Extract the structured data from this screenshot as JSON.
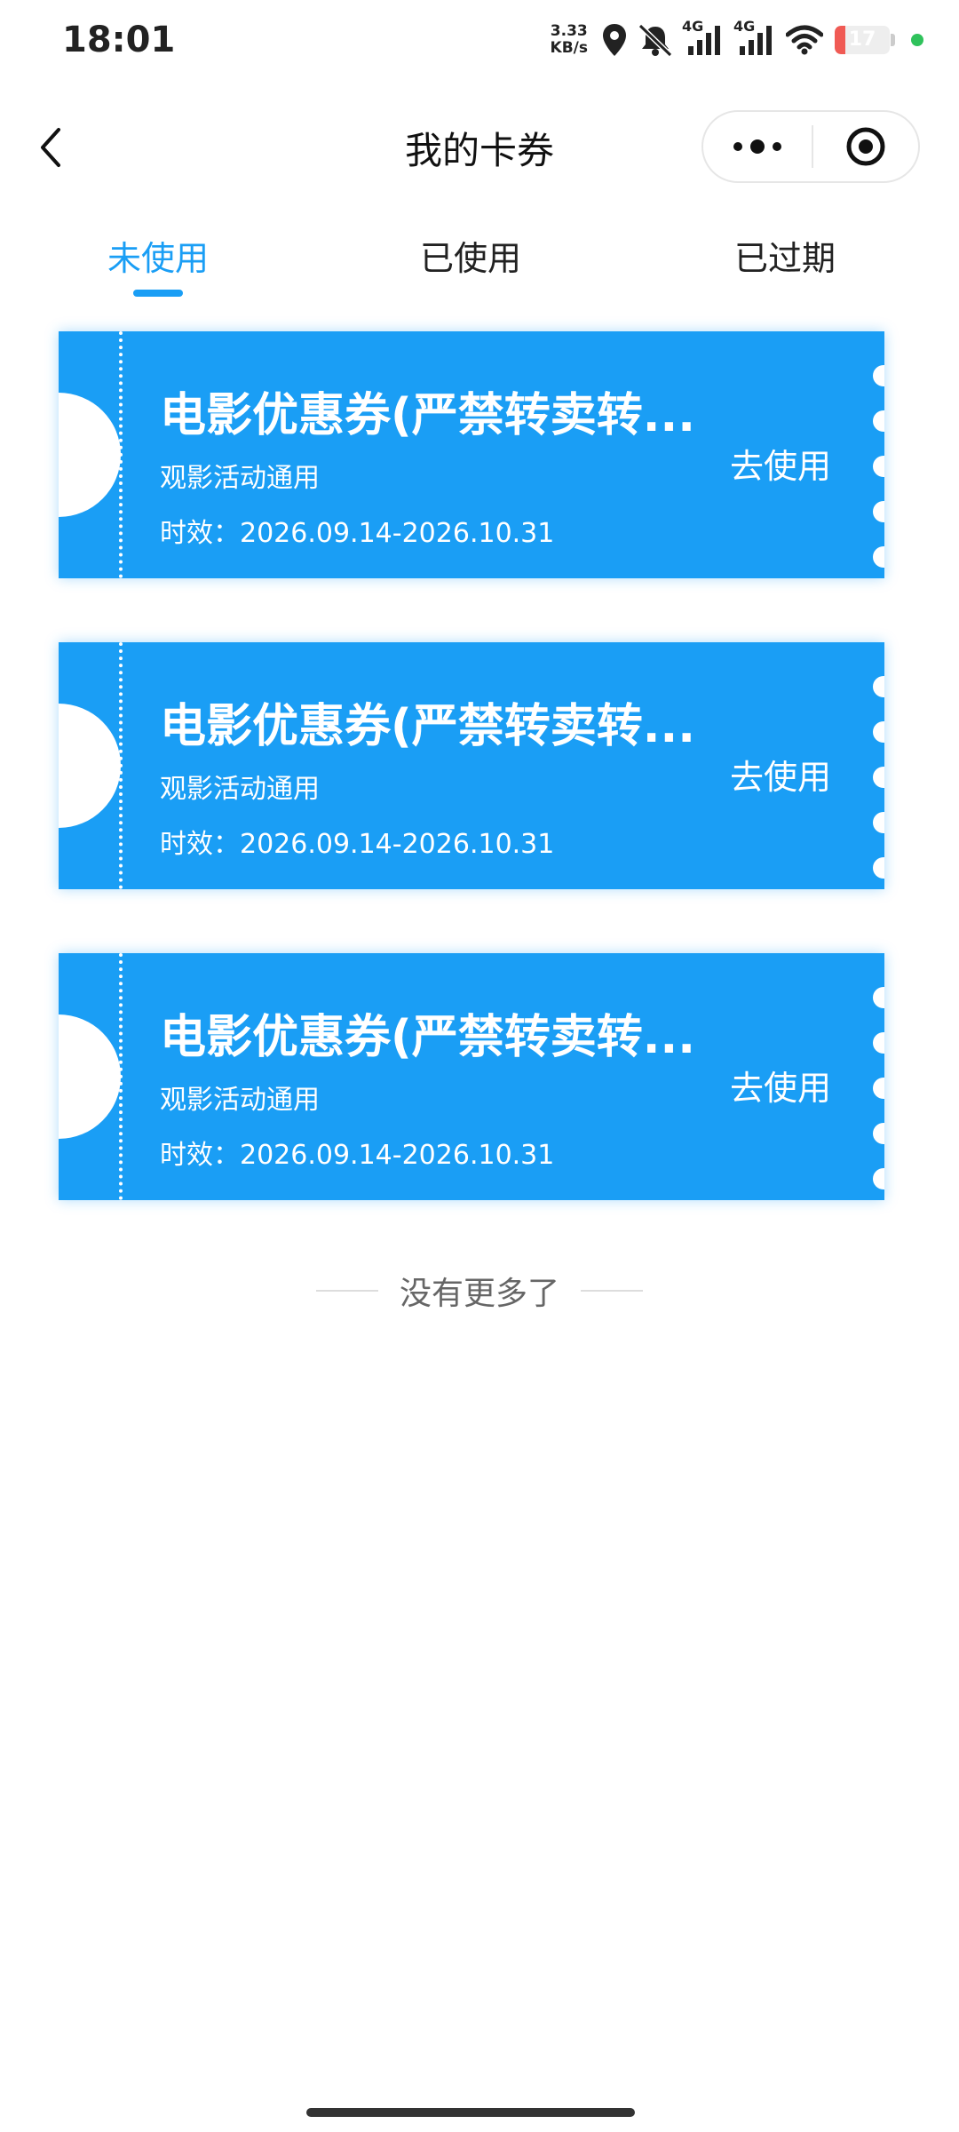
{
  "status_bar": {
    "time": "18:01",
    "net_speed_value": "3.33",
    "net_speed_unit": "KB/s",
    "signal1_label": "4G",
    "signal2_label": "4G",
    "battery_level": "17",
    "icons": [
      "location-icon",
      "mute-icon",
      "signal-icon",
      "signal-icon",
      "wifi-icon",
      "battery-icon"
    ]
  },
  "nav": {
    "title": "我的卡券",
    "back_icon": "back-chevron-icon",
    "more_icon": "more-dots-icon",
    "close_icon": "target-close-icon"
  },
  "tabs": [
    {
      "label": "未使用",
      "active": true
    },
    {
      "label": "已使用",
      "active": false
    },
    {
      "label": "已过期",
      "active": false
    }
  ],
  "coupons": [
    {
      "title": "电影优惠券(严禁转卖转...",
      "subtitle": "观影活动通用",
      "validity": "时效：2026.09.14-2026.10.31",
      "action": "去使用"
    },
    {
      "title": "电影优惠券(严禁转卖转...",
      "subtitle": "观影活动通用",
      "validity": "时效：2026.09.14-2026.10.31",
      "action": "去使用"
    },
    {
      "title": "电影优惠券(严禁转卖转...",
      "subtitle": "观影活动通用",
      "validity": "时效：2026.09.14-2026.10.31",
      "action": "去使用"
    }
  ],
  "footer": {
    "no_more": "没有更多了"
  },
  "colors": {
    "accent": "#1a9ef5",
    "battery_low": "#f05a54",
    "status_dot": "#2fc25b"
  }
}
